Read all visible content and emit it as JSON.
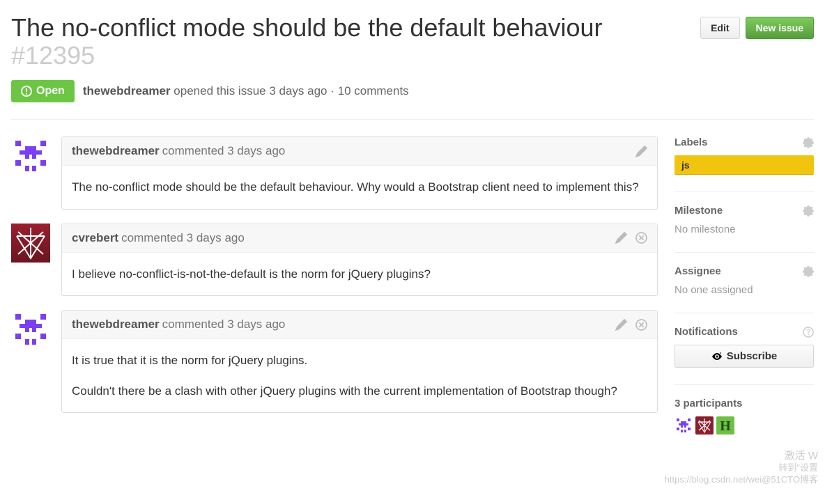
{
  "issue": {
    "title": "The no-conflict mode should be the default behaviour",
    "number": "#12395",
    "state": "Open",
    "author": "thewebdreamer",
    "opened_text": "opened this issue 3 days ago",
    "comments_text": "10 comments"
  },
  "header_buttons": {
    "edit": "Edit",
    "new_issue": "New issue"
  },
  "comments": [
    {
      "author": "thewebdreamer",
      "meta": "commented 3 days ago",
      "body": [
        "The no-conflict mode should be the default behaviour. Why would a Bootstrap client need to implement this?"
      ],
      "avatar": "purple",
      "can_delete": false
    },
    {
      "author": "cvrebert",
      "meta": "commented 3 days ago",
      "body": [
        "I believe no-conflict-is-not-the-default is the norm for jQuery plugins?"
      ],
      "avatar": "red",
      "can_delete": true
    },
    {
      "author": "thewebdreamer",
      "meta": "commented 3 days ago",
      "body": [
        "It is true that it is the norm for jQuery plugins.",
        "Couldn't there be a clash with other jQuery plugins with the current implementation of Bootstrap though?"
      ],
      "avatar": "purple",
      "can_delete": true
    }
  ],
  "sidebar": {
    "labels_title": "Labels",
    "labels": [
      {
        "name": "js",
        "color": "#f1c40f"
      }
    ],
    "milestone_title": "Milestone",
    "milestone_text": "No milestone",
    "assignee_title": "Assignee",
    "assignee_text": "No one assigned",
    "notifications_title": "Notifications",
    "subscribe": "Subscribe",
    "participants_title": "3 participants"
  },
  "watermark": {
    "l1": "激活 W",
    "l2": "转到\"设置",
    "l3": "https://blog.csdn.net/wei@51CTO博客"
  }
}
